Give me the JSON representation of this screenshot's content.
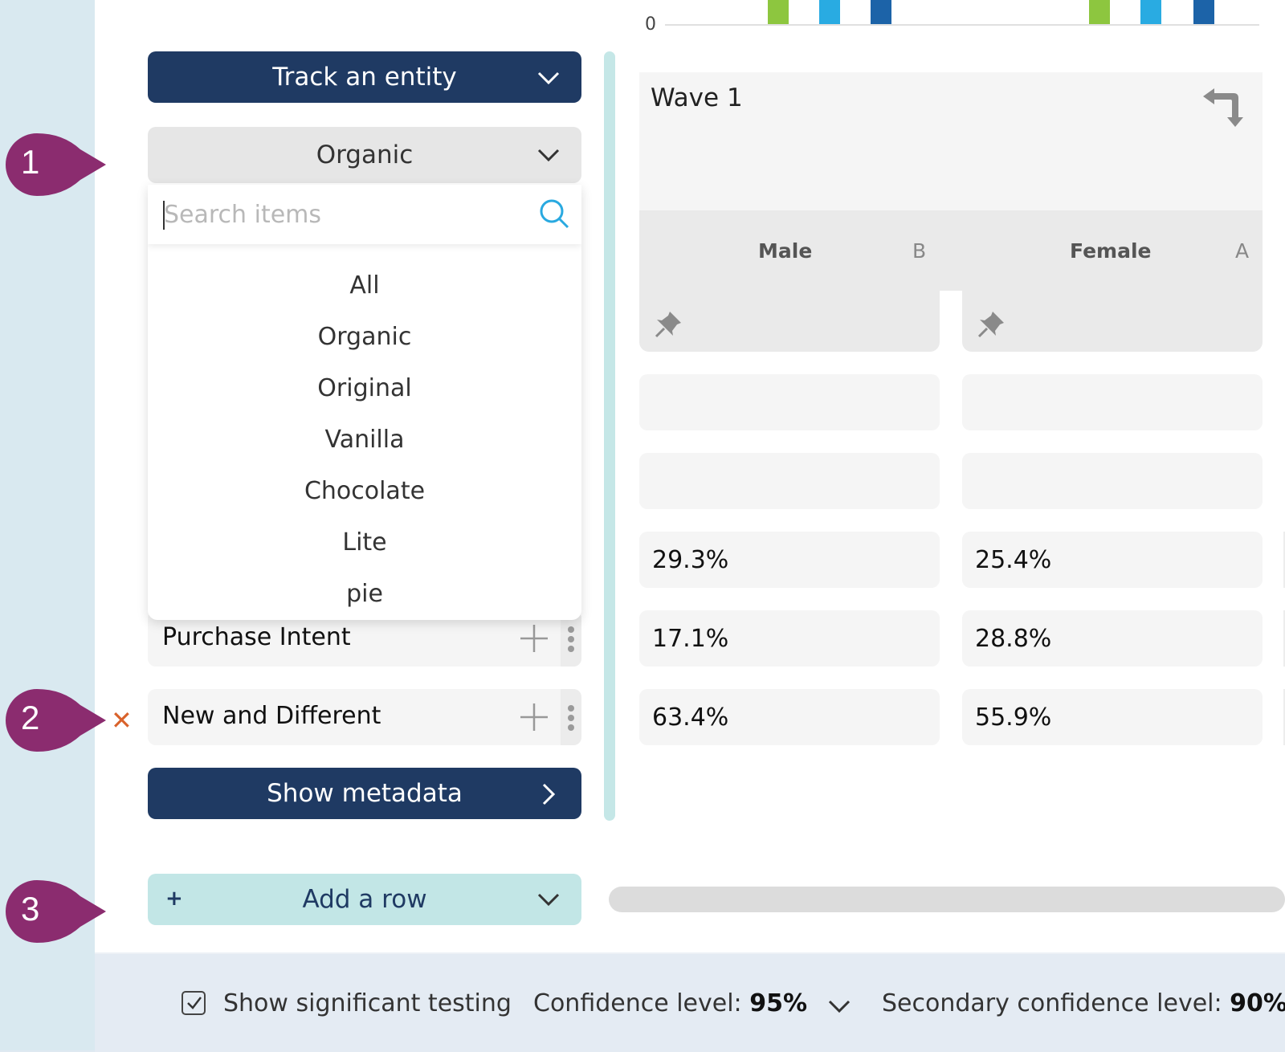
{
  "chart": {
    "axis_zero": "0",
    "bar_colors": [
      "#8dc63f",
      "#29abe2",
      "#1c63a8"
    ]
  },
  "left": {
    "track_button": "Track an entity",
    "selected_variant": "Organic",
    "search_placeholder": "Search items",
    "options": [
      "All",
      "Organic",
      "Original",
      "Vanilla",
      "Chocolate",
      "Lite",
      "pie"
    ],
    "rows": [
      "Purchase Intent",
      "New and Different"
    ],
    "metadata_button": "Show metadata",
    "add_row_button": "Add a row"
  },
  "table": {
    "wave_title": "Wave 1",
    "columns": [
      {
        "name": "Male",
        "code": "B"
      },
      {
        "name": "Female",
        "code": "A"
      }
    ],
    "values": [
      [
        "29.3%",
        "25.4%"
      ],
      [
        "17.1%",
        "28.8%"
      ],
      [
        "63.4%",
        "55.9%"
      ]
    ]
  },
  "callouts": [
    "1",
    "2",
    "3"
  ],
  "footer": {
    "sig_label": "Show significant testing",
    "sig_checked": true,
    "confidence_label": "Confidence level:",
    "confidence_value": "95%",
    "secondary_label": "Secondary confidence level:",
    "secondary_value": "90%"
  },
  "colors": {
    "navy": "#1f3a63",
    "teal": "#c2e6e6",
    "callout": "#8b2c6f",
    "remove": "#d9622b"
  }
}
